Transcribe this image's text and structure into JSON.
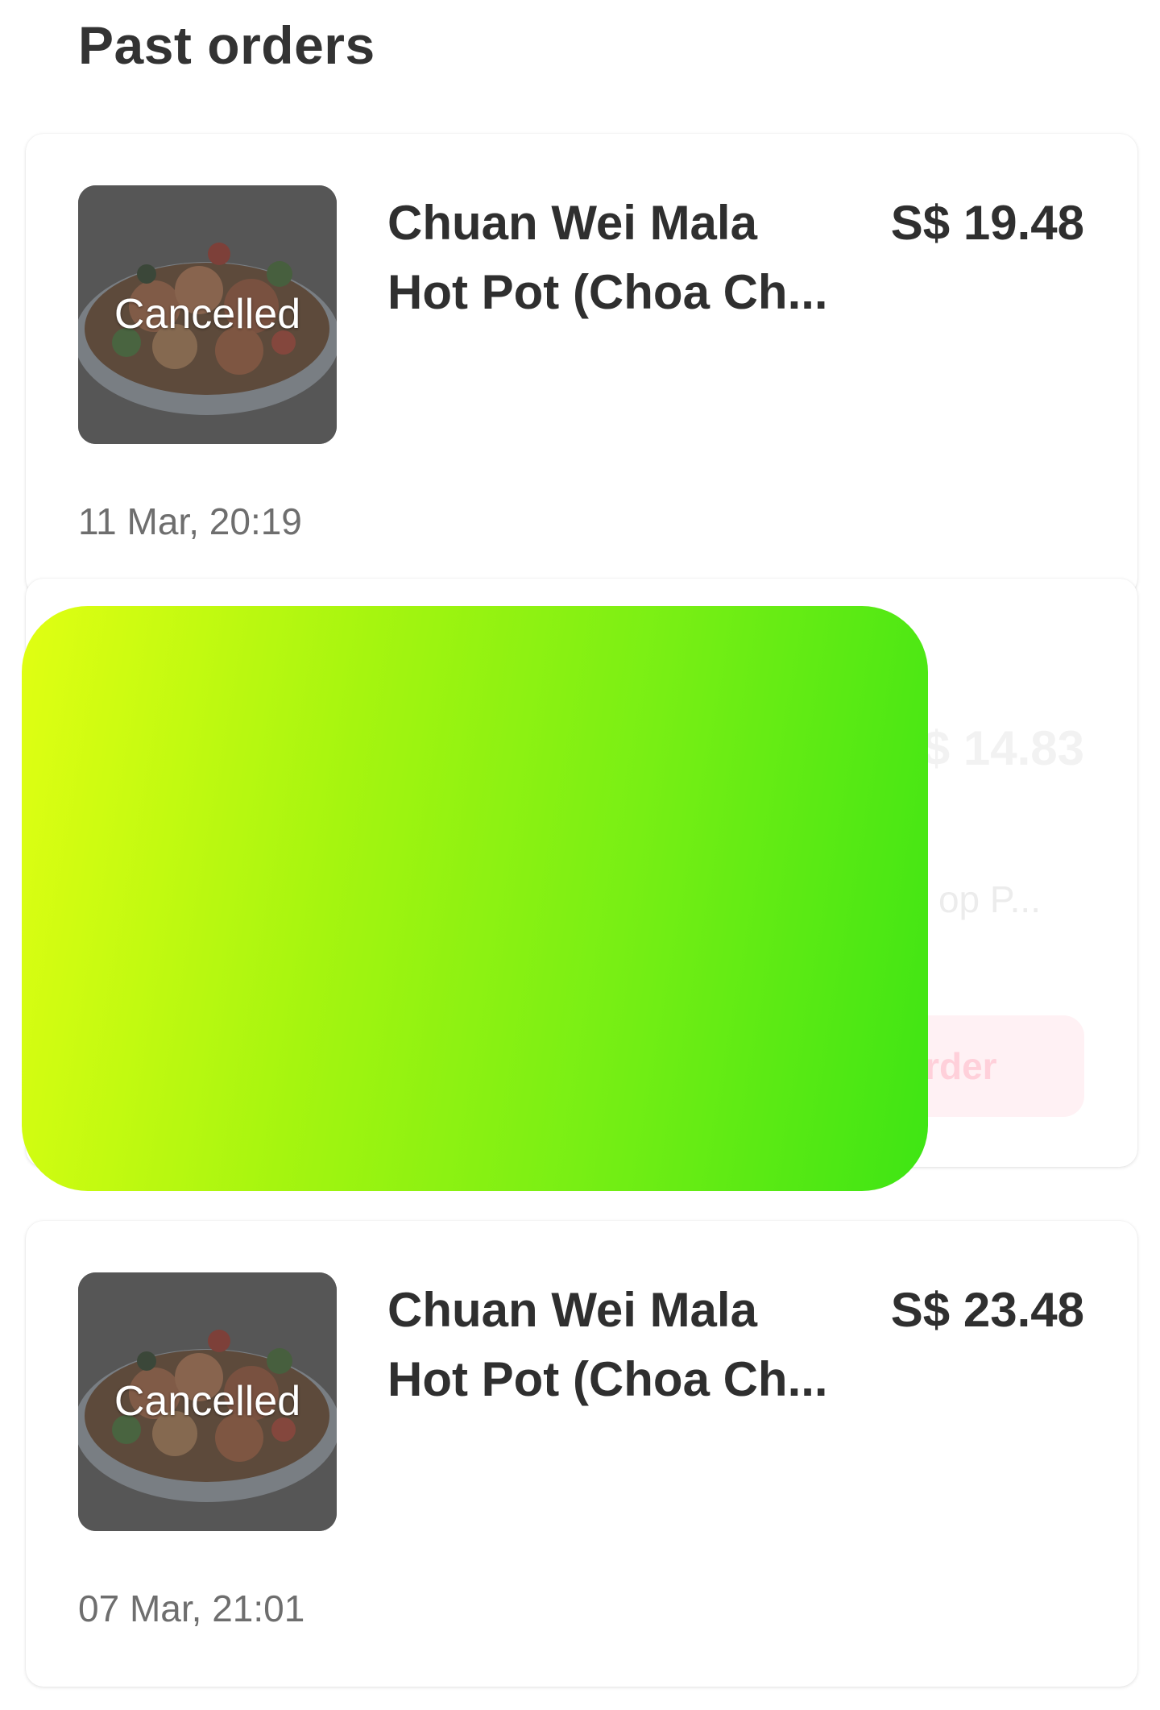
{
  "page": {
    "title": "Past orders"
  },
  "orders": [
    {
      "restaurant": "Chuan Wei Mala Hot Pot (Choa Ch...",
      "price": "S$ 19.48",
      "status": "Cancelled",
      "date": "11 Mar, 20:19",
      "thumbnail_icon": "food-bowl-image"
    },
    {
      "price": "S$ 14.83",
      "items_snippet": "op P...",
      "reorder_label": "eorder"
    },
    {
      "restaurant": "Chuan Wei Mala Hot Pot (Choa Ch...",
      "price": "S$ 23.48",
      "status": "Cancelled",
      "date": "07 Mar, 21:01",
      "thumbnail_icon": "food-bowl-image"
    }
  ],
  "colors": {
    "overlay_gradient_start": "#e1ff12",
    "overlay_gradient_end": "#3ee514",
    "reorder_bg": "#fff1f4"
  }
}
